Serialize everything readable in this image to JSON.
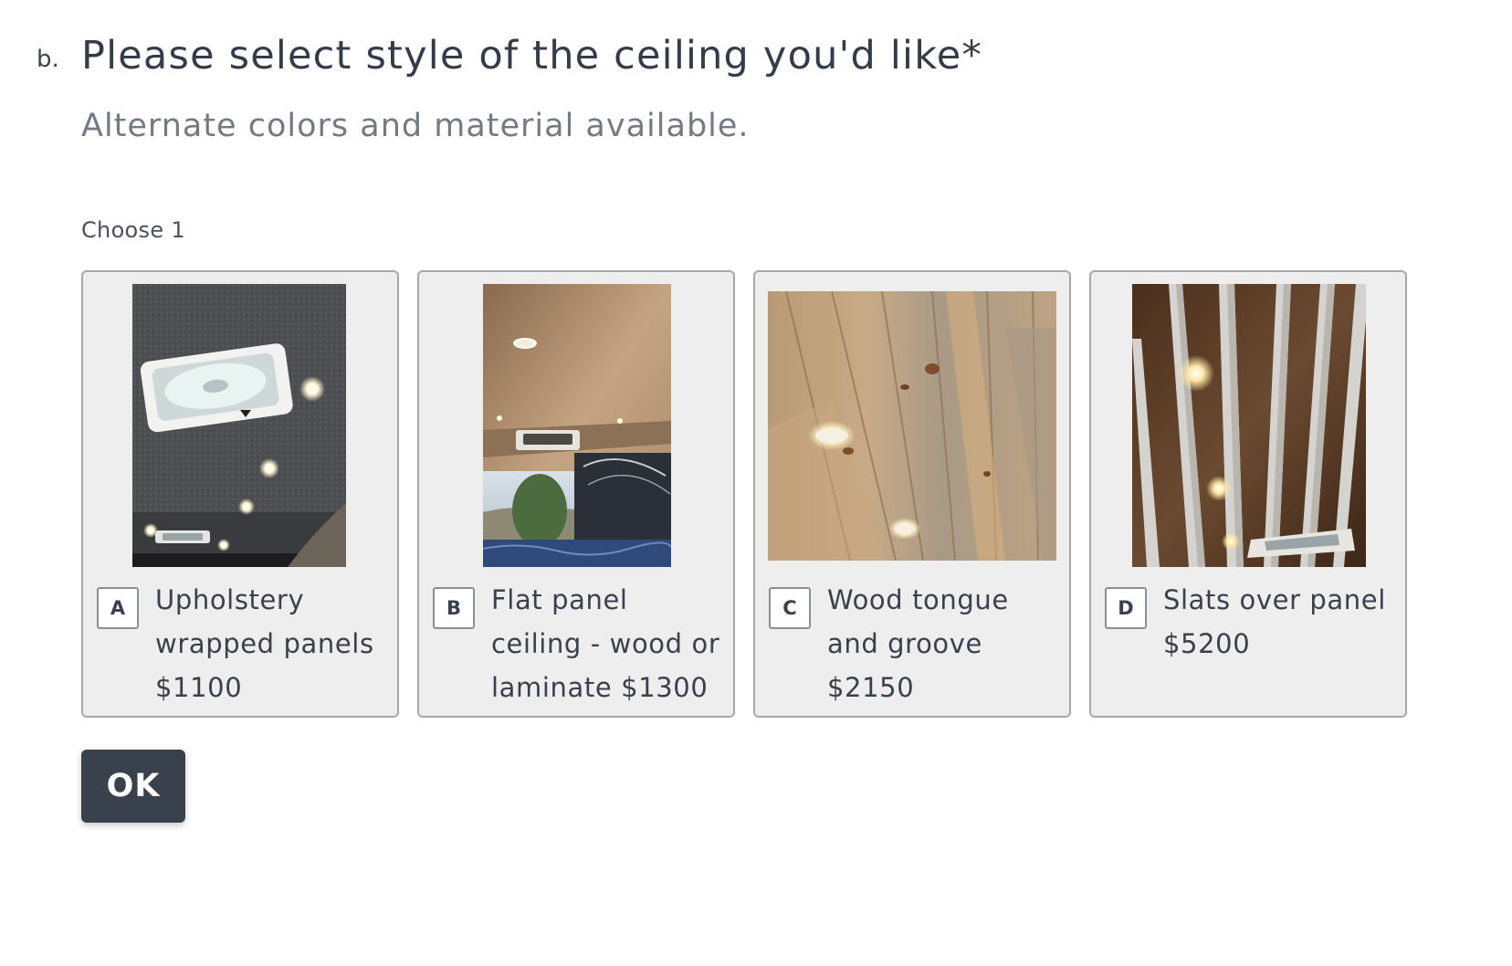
{
  "question": {
    "number": "b.",
    "title": "Please select style of the ceiling you'd like*",
    "subtitle": "Alternate colors and material available."
  },
  "choose_hint": "Choose 1",
  "choices": [
    {
      "key": "A",
      "label": "Upholstery wrapped panels $1100",
      "image": "upholstery-ceiling-photo"
    },
    {
      "key": "B",
      "label": "Flat panel ceiling - wood or laminate $1300",
      "image": "flat-panel-ceiling-photo"
    },
    {
      "key": "C",
      "label": "Wood tongue and groove $2150",
      "image": "wood-tongue-groove-ceiling-photo"
    },
    {
      "key": "D",
      "label": "Slats over panel $5200",
      "image": "slats-over-panel-ceiling-photo"
    }
  ],
  "ok_button": {
    "label": "OK"
  },
  "colors": {
    "text": "#333c48",
    "muted": "#747a82",
    "choice_bg": "#eeeeee",
    "choice_border": "#a8a8a8",
    "button_bg": "#39414c",
    "button_text": "#ffffff"
  }
}
